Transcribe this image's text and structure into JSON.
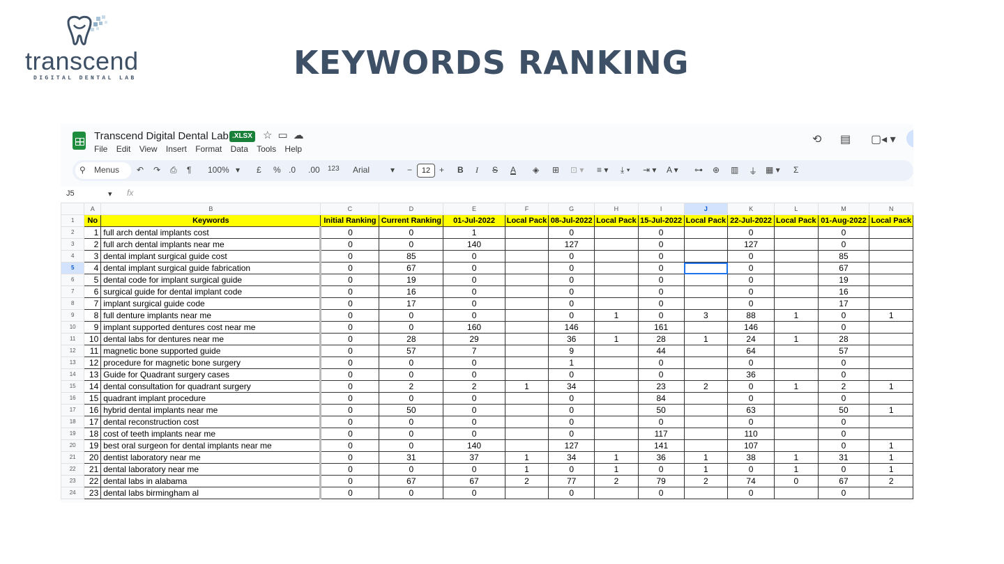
{
  "slide": {
    "logo_word": "transcend",
    "logo_tagline": "DIGITAL DENTAL LAB",
    "title": "KEYWORDS RANKING"
  },
  "sheets": {
    "doc_title": "Transcend Digital Dental Lab",
    "badge": ".XLSX",
    "menu": [
      "File",
      "Edit",
      "View",
      "Insert",
      "Format",
      "Data",
      "Tools",
      "Help"
    ],
    "toolbar": {
      "menus": "Menus",
      "zoom": "100%",
      "currency": "£",
      "percent": "%",
      "dec_decrease": ".0",
      "dec_increase": ".00",
      "number_format": "123",
      "font": "Arial",
      "font_size": "12",
      "bold": "B",
      "italic": "I",
      "text_color": "A"
    },
    "name_box": "J5",
    "fx": "fx",
    "columns": [
      "A",
      "B",
      "C",
      "D",
      "E",
      "F",
      "G",
      "H",
      "I",
      "J",
      "K",
      "L",
      "M",
      "N"
    ],
    "selected_column": "J",
    "selected_row": "5",
    "header_row": [
      "No",
      "Keywords",
      "Initial Ranking",
      "Current Ranking",
      "01-Jul-2022",
      "Local Pack",
      "08-Jul-2022",
      "Local Pack",
      "15-Jul-2022",
      "Local Pack",
      "22-Jul-2022",
      "Local Pack",
      "01-Aug-2022",
      "Local Pack"
    ],
    "rows": [
      [
        "1",
        "full arch dental implants cost",
        "0",
        "0",
        "1",
        "",
        "0",
        "",
        "0",
        "",
        "0",
        "",
        "0",
        ""
      ],
      [
        "2",
        "full arch dental implants near me",
        "0",
        "0",
        "140",
        "",
        "127",
        "",
        "0",
        "",
        "127",
        "",
        "0",
        ""
      ],
      [
        "3",
        "dental implant surgical guide cost",
        "0",
        "85",
        "0",
        "",
        "0",
        "",
        "0",
        "",
        "0",
        "",
        "85",
        ""
      ],
      [
        "4",
        "dental implant surgical guide fabrication",
        "0",
        "67",
        "0",
        "",
        "0",
        "",
        "0",
        "",
        "0",
        "",
        "67",
        ""
      ],
      [
        "5",
        "dental code for implant surgical guide",
        "0",
        "19",
        "0",
        "",
        "0",
        "",
        "0",
        "",
        "0",
        "",
        "19",
        ""
      ],
      [
        "6",
        "surgical guide for dental implant code",
        "0",
        "16",
        "0",
        "",
        "0",
        "",
        "0",
        "",
        "0",
        "",
        "16",
        ""
      ],
      [
        "7",
        "implant surgical guide code",
        "0",
        "17",
        "0",
        "",
        "0",
        "",
        "0",
        "",
        "0",
        "",
        "17",
        ""
      ],
      [
        "8",
        "full denture implants near me",
        "0",
        "0",
        "0",
        "",
        "0",
        "1",
        "0",
        "3",
        "88",
        "1",
        "0",
        "1"
      ],
      [
        "9",
        "implant supported dentures cost near me",
        "0",
        "0",
        "160",
        "",
        "146",
        "",
        "161",
        "",
        "146",
        "",
        "0",
        ""
      ],
      [
        "10",
        "dental labs for dentures near me",
        "0",
        "28",
        "29",
        "",
        "36",
        "1",
        "28",
        "1",
        "24",
        "1",
        "28",
        ""
      ],
      [
        "11",
        "magnetic bone supported guide",
        "0",
        "57",
        "7",
        "",
        "9",
        "",
        "44",
        "",
        "64",
        "",
        "57",
        ""
      ],
      [
        "12",
        "procedure for magnetic bone surgery",
        "0",
        "0",
        "0",
        "",
        "1",
        "",
        "0",
        "",
        "0",
        "",
        "0",
        ""
      ],
      [
        "13",
        "Guide for Quadrant surgery cases",
        "0",
        "0",
        "0",
        "",
        "0",
        "",
        "0",
        "",
        "36",
        "",
        "0",
        ""
      ],
      [
        "14",
        "dental consultation for quadrant surgery",
        "0",
        "2",
        "2",
        "1",
        "34",
        "",
        "23",
        "2",
        "0",
        "1",
        "2",
        "1"
      ],
      [
        "15",
        "quadrant implant procedure",
        "0",
        "0",
        "0",
        "",
        "0",
        "",
        "84",
        "",
        "0",
        "",
        "0",
        ""
      ],
      [
        "16",
        "hybrid dental implants near me",
        "0",
        "50",
        "0",
        "",
        "0",
        "",
        "50",
        "",
        "63",
        "",
        "50",
        "1"
      ],
      [
        "17",
        "dental reconstruction cost",
        "0",
        "0",
        "0",
        "",
        "0",
        "",
        "0",
        "",
        "0",
        "",
        "0",
        ""
      ],
      [
        "18",
        "cost of teeth implants near me",
        "0",
        "0",
        "0",
        "",
        "0",
        "",
        "117",
        "",
        "110",
        "",
        "0",
        ""
      ],
      [
        "19",
        "best oral surgeon for dental implants near me",
        "0",
        "0",
        "140",
        "",
        "127",
        "",
        "141",
        "",
        "107",
        "",
        "0",
        "1"
      ],
      [
        "20",
        "dentist laboratory near me",
        "0",
        "31",
        "37",
        "1",
        "34",
        "1",
        "36",
        "1",
        "38",
        "1",
        "31",
        "1"
      ],
      [
        "21",
        "dental laboratory near me",
        "0",
        "0",
        "0",
        "1",
        "0",
        "1",
        "0",
        "1",
        "0",
        "1",
        "0",
        "1"
      ],
      [
        "22",
        "dental labs in alabama",
        "0",
        "67",
        "67",
        "2",
        "77",
        "2",
        "79",
        "2",
        "74",
        "0",
        "67",
        "2"
      ],
      [
        "23",
        "dental labs birmingham al",
        "0",
        "0",
        "0",
        "",
        "0",
        "",
        "0",
        "",
        "0",
        "",
        "0",
        ""
      ]
    ],
    "colors": {
      "header_fill": "#ffff00",
      "selection": "#1a73e8",
      "app_green": "#1e8e3e",
      "title_color": "#3e5066"
    }
  }
}
